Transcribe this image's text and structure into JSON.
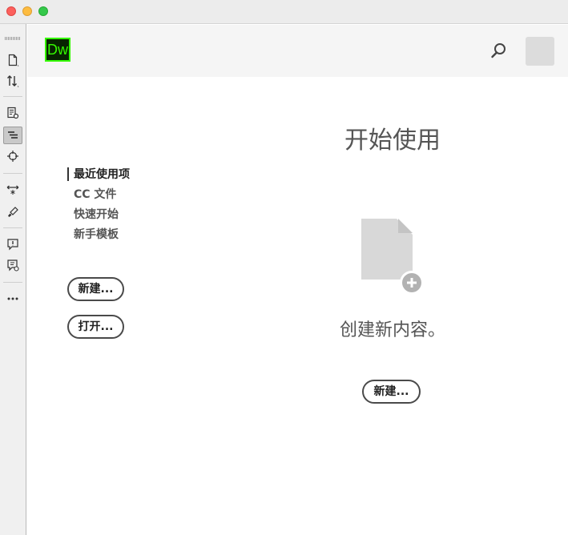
{
  "app": {
    "logo_text": "Dw"
  },
  "nav": {
    "items": [
      {
        "label": "最近使用项",
        "active": true
      },
      {
        "label": "CC 文件",
        "active": false
      },
      {
        "label": "快速开始",
        "active": false
      },
      {
        "label": "新手模板",
        "active": false
      }
    ]
  },
  "sidebar_buttons": {
    "new_label": "新建...",
    "open_label": "打开..."
  },
  "main": {
    "title": "开始使用",
    "create_text": "创建新内容。",
    "new_label": "新建..."
  },
  "colors": {
    "brand_fg": "#35fa00",
    "brand_bg": "#072401"
  },
  "icons": {
    "toolbar": [
      "document-icon",
      "transfer-icon",
      "inspect-icon",
      "code-view-icon",
      "target-icon",
      "expand-icon",
      "brush-icon",
      "comment-icon",
      "comment-check-icon",
      "more-icon"
    ],
    "header": [
      "search-icon",
      "avatar"
    ],
    "main": [
      "new-file-icon",
      "plus-icon"
    ]
  }
}
